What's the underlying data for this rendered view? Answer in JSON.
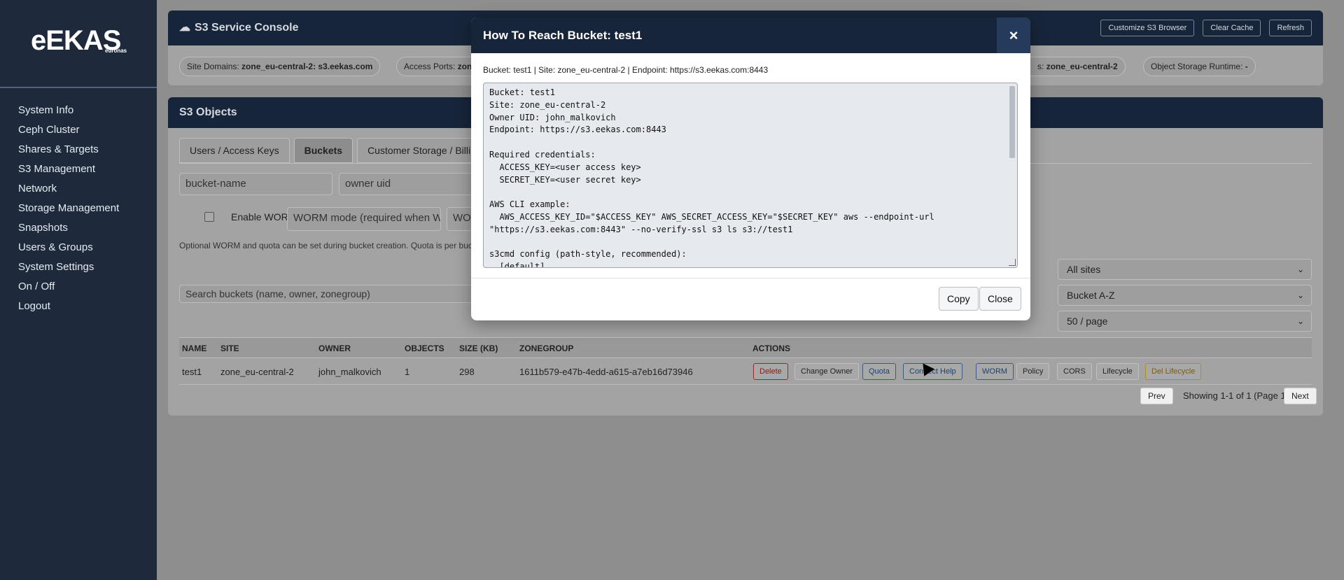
{
  "brand": {
    "logo": "eEKAS",
    "sub": "euronas"
  },
  "sidebar": {
    "items": [
      {
        "label": "System Info"
      },
      {
        "label": "Ceph Cluster"
      },
      {
        "label": "Shares & Targets"
      },
      {
        "label": "S3 Management"
      },
      {
        "label": "Network"
      },
      {
        "label": "Storage Management"
      },
      {
        "label": "Snapshots"
      },
      {
        "label": "Users & Groups"
      },
      {
        "label": "System Settings"
      },
      {
        "label": "On / Off"
      },
      {
        "label": "Logout"
      }
    ]
  },
  "console": {
    "title": "S3 Service Console",
    "buttons": {
      "customize": "Customize S3 Browser",
      "clear_cache": "Clear Cache",
      "refresh": "Refresh"
    },
    "pills": {
      "site_domains_label": "Site Domains:",
      "site_domains_value": "zone_eu-central-2: s3.eekas.com",
      "access_ports_label": "Access Ports:",
      "access_ports_value": "zon",
      "zone_label": "s:",
      "zone_value": "zone_eu-central-2",
      "runtime_label": "Object Storage Runtime:",
      "runtime_value": "-"
    }
  },
  "objects": {
    "title": "S3 Objects",
    "tabs": [
      {
        "label": "Users / Access Keys"
      },
      {
        "label": "Buckets"
      },
      {
        "label": "Customer Storage / Billing"
      }
    ],
    "form": {
      "bucket_placeholder": "bucket-name",
      "owner_placeholder": "owner uid",
      "worm_label": "Enable WORM",
      "worm_mode": "WORM mode (required when W",
      "worm_extra": "WOR",
      "hint": "Optional WORM and quota can be set during bucket creation. Quota is per buc"
    },
    "search_placeholder": "Search buckets (name, owner, zonegroup)",
    "filters": {
      "sites": "All sites",
      "sort": "Bucket A-Z",
      "per_page": "50 / page"
    },
    "table": {
      "headers": {
        "name": "NAME",
        "site": "SITE",
        "owner": "OWNER",
        "objects": "OBJECTS",
        "size": "SIZE (KB)",
        "zonegroup": "ZONEGROUP",
        "actions": "ACTIONS"
      },
      "rows": [
        {
          "name": "test1",
          "site": "zone_eu-central-2",
          "owner": "john_malkovich",
          "objects": "1",
          "size": "298",
          "zonegroup": "1611b579-e47b-4edd-a615-a7eb16d73946"
        }
      ],
      "actions": {
        "delete": "Delete",
        "change_owner": "Change Owner",
        "quota": "Quota",
        "connect_help": "Connect Help",
        "worm": "WORM",
        "policy": "Policy",
        "cors": "CORS",
        "lifecycle": "Lifecycle",
        "del_lifecycle": "Del Lifecycle"
      }
    },
    "pager": {
      "prev": "Prev",
      "status": "Showing 1-1 of 1 (Page 1/1)",
      "next": "Next"
    }
  },
  "modal": {
    "title": "How To Reach Bucket: test1",
    "close_icon": "×",
    "subtitle": "Bucket: test1 | Site: zone_eu-central-2 | Endpoint: https://s3.eekas.com:8443",
    "code": "Bucket: test1\nSite: zone_eu-central-2\nOwner UID: john_malkovich\nEndpoint: https://s3.eekas.com:8443\n\nRequired credentials:\n  ACCESS_KEY=<user access key>\n  SECRET_KEY=<user secret key>\n\nAWS CLI example:\n  AWS_ACCESS_KEY_ID=\"$ACCESS_KEY\" AWS_SECRET_ACCESS_KEY=\"$SECRET_KEY\" aws --endpoint-url\n\"https://s3.eekas.com:8443\" --no-verify-ssl s3 ls s3://test1\n\ns3cmd config (path-style, recommended):\n  [default]",
    "copy_label": "Copy",
    "close_label": "Close"
  }
}
